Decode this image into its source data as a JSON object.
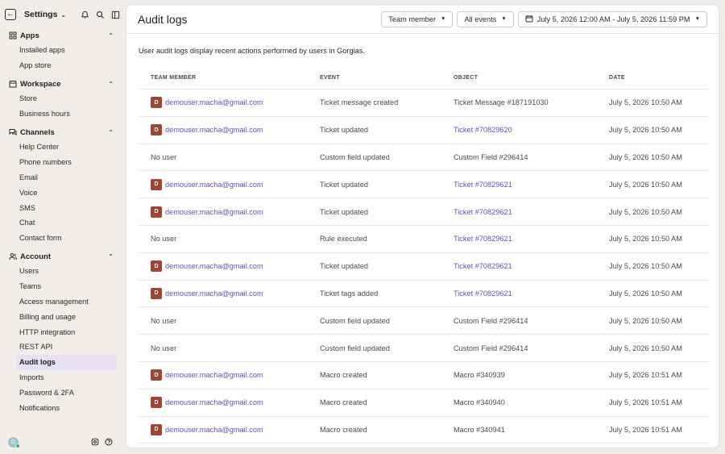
{
  "sidebar": {
    "title": "Settings",
    "sections": [
      {
        "label": "Apps",
        "icon": "apps-grid-icon",
        "items": [
          "Installed apps",
          "App store"
        ]
      },
      {
        "label": "Workspace",
        "icon": "store-icon",
        "items": [
          "Store",
          "Business hours"
        ]
      },
      {
        "label": "Channels",
        "icon": "chat-icon",
        "items": [
          "Help Center",
          "Phone numbers",
          "Email",
          "Voice",
          "SMS",
          "Chat",
          "Contact form"
        ]
      },
      {
        "label": "Account",
        "icon": "users-icon",
        "items": [
          "Users",
          "Teams",
          "Access management",
          "Billing and usage",
          "HTTP integration",
          "REST API",
          "Audit logs",
          "Imports",
          "Password & 2FA",
          "Notifications"
        ]
      }
    ],
    "active_item": "Audit logs",
    "user_initial": "D"
  },
  "header": {
    "title": "Audit logs",
    "filters": {
      "team_member": "Team member",
      "events": "All events",
      "date_range": "July 5, 2026 12:00 AM - July 5, 2026 11:59 PM"
    }
  },
  "description": "User audit logs display recent actions performed by users in Gorgias.",
  "table": {
    "columns": [
      "TEAM MEMBER",
      "EVENT",
      "OBJECT",
      "DATE"
    ],
    "rows": [
      {
        "member": "demouser.macha@gmail.com",
        "avatar": "D",
        "event": "Ticket message created",
        "object": "Ticket Message #187191030",
        "object_link": false,
        "date": "July 5, 2026 10:50 AM"
      },
      {
        "member": "demouser.macha@gmail.com",
        "avatar": "D",
        "event": "Ticket updated",
        "object": "Ticket #70829620",
        "object_link": true,
        "date": "July 5, 2026 10:50 AM"
      },
      {
        "member": "No user",
        "avatar": "",
        "event": "Custom field updated",
        "object": "Custom Field #296414",
        "object_link": false,
        "date": "July 5, 2026 10:50 AM"
      },
      {
        "member": "demouser.macha@gmail.com",
        "avatar": "D",
        "event": "Ticket updated",
        "object": "Ticket #70829621",
        "object_link": true,
        "date": "July 5, 2026 10:50 AM"
      },
      {
        "member": "demouser.macha@gmail.com",
        "avatar": "D",
        "event": "Ticket updated",
        "object": "Ticket #70829621",
        "object_link": true,
        "date": "July 5, 2026 10:50 AM"
      },
      {
        "member": "No user",
        "avatar": "",
        "event": "Rule executed",
        "object": "Ticket #70829621",
        "object_link": true,
        "date": "July 5, 2026 10:50 AM"
      },
      {
        "member": "demouser.macha@gmail.com",
        "avatar": "D",
        "event": "Ticket updated",
        "object": "Ticket #70829621",
        "object_link": true,
        "date": "July 5, 2026 10:50 AM"
      },
      {
        "member": "demouser.macha@gmail.com",
        "avatar": "D",
        "event": "Ticket tags added",
        "object": "Ticket #70829621",
        "object_link": true,
        "date": "July 5, 2026 10:50 AM"
      },
      {
        "member": "No user",
        "avatar": "",
        "event": "Custom field updated",
        "object": "Custom Field #296414",
        "object_link": false,
        "date": "July 5, 2026 10:50 AM"
      },
      {
        "member": "No user",
        "avatar": "",
        "event": "Custom field updated",
        "object": "Custom Field #296414",
        "object_link": false,
        "date": "July 5, 2026 10:50 AM"
      },
      {
        "member": "demouser.macha@gmail.com",
        "avatar": "D",
        "event": "Macro created",
        "object": "Macro #340939",
        "object_link": false,
        "date": "July 5, 2026 10:51 AM"
      },
      {
        "member": "demouser.macha@gmail.com",
        "avatar": "D",
        "event": "Macro created",
        "object": "Macro #340940",
        "object_link": false,
        "date": "July 5, 2026 10:51 AM"
      },
      {
        "member": "demouser.macha@gmail.com",
        "avatar": "D",
        "event": "Macro created",
        "object": "Macro #340941",
        "object_link": false,
        "date": "July 5, 2026 10:51 AM"
      }
    ]
  }
}
